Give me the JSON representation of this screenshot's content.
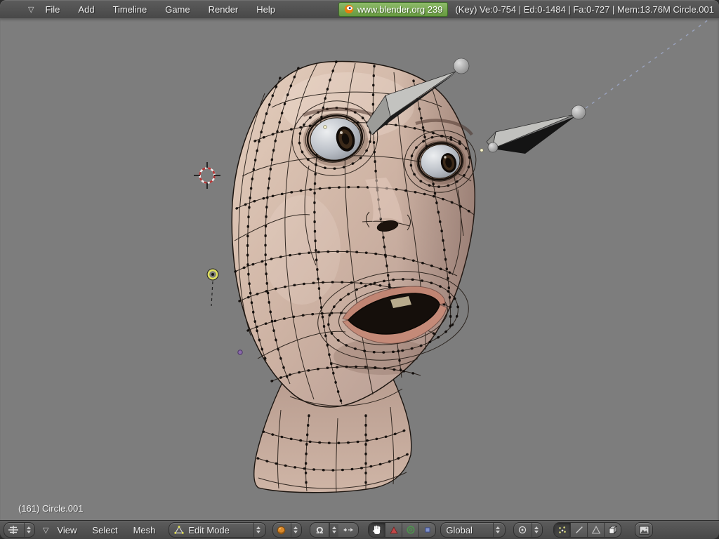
{
  "top_bar": {
    "menus": [
      "File",
      "Add",
      "Timeline",
      "Game",
      "Render",
      "Help"
    ],
    "badge_label": "www.blender.org 239",
    "stats": "(Key) Ve:0-754 | Ed:0-1484 | Fa:0-727 | Mem:13.76M Circle.001"
  },
  "viewport": {
    "object_info": "(161) Circle.001"
  },
  "bottom_bar": {
    "menus": [
      "View",
      "Select",
      "Mesh"
    ],
    "mode_label": "Edit Mode",
    "orientation_label": "Global"
  },
  "icons": {
    "collapse": "▽",
    "proportional": "Ω"
  },
  "colors": {
    "header_bg": "#4d4d4d",
    "viewport_bg": "#7d7d7d",
    "badge_green": "#74a850",
    "skin": "#cdb2a3",
    "wireframe": "#1c1510"
  }
}
